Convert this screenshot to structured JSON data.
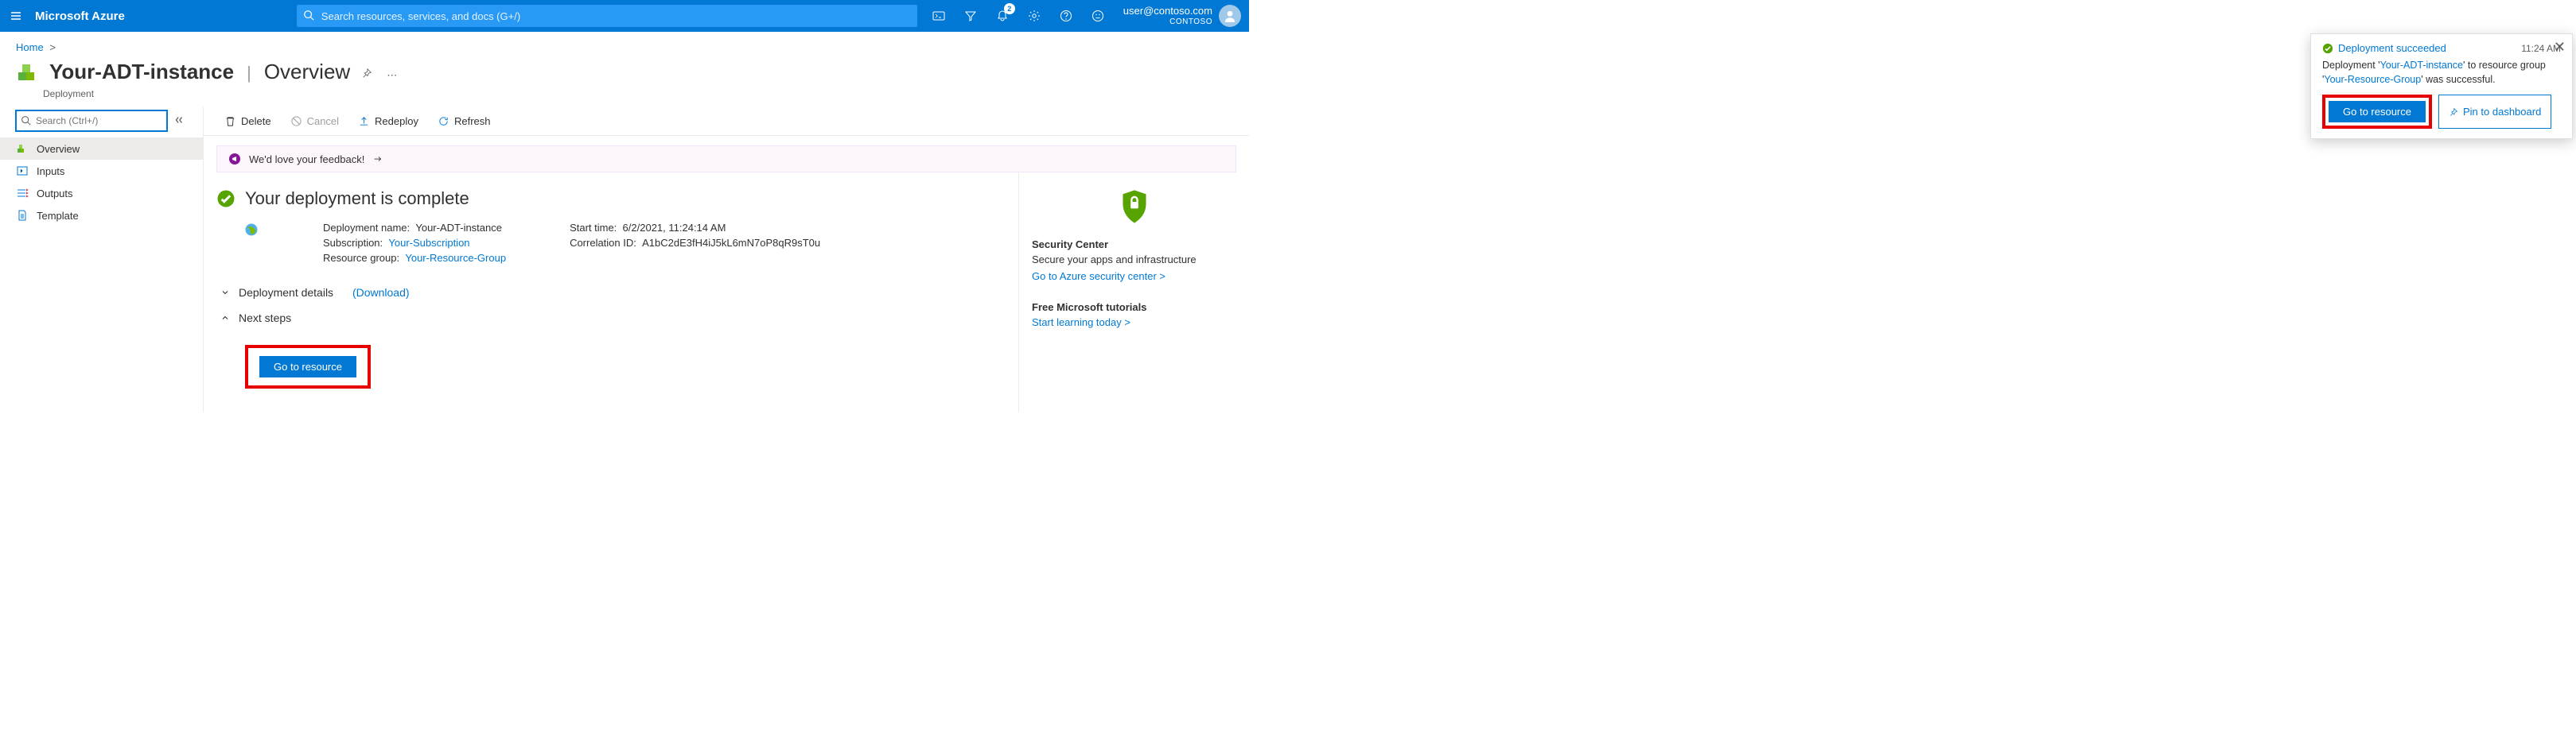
{
  "topbar": {
    "brand": "Microsoft Azure",
    "search_placeholder": "Search resources, services, and docs (G+/)",
    "notification_count": "2",
    "account_email": "user@contoso.com",
    "account_tenant": "CONTOSO"
  },
  "breadcrumb": {
    "home": "Home"
  },
  "blade": {
    "title": "Your-ADT-instance",
    "section": "Overview",
    "subtitle": "Deployment"
  },
  "sidebar": {
    "search_placeholder": "Search (Ctrl+/)",
    "items": [
      {
        "label": "Overview",
        "icon": "overview",
        "active": true
      },
      {
        "label": "Inputs",
        "icon": "inputs"
      },
      {
        "label": "Outputs",
        "icon": "outputs"
      },
      {
        "label": "Template",
        "icon": "template"
      }
    ]
  },
  "commands": {
    "delete": "Delete",
    "cancel": "Cancel",
    "redeploy": "Redeploy",
    "refresh": "Refresh"
  },
  "feedback": {
    "text": "We'd love your feedback!"
  },
  "status": {
    "title": "Your deployment is complete"
  },
  "details": {
    "deployment_name_label": "Deployment name:",
    "deployment_name": "Your-ADT-instance",
    "subscription_label": "Subscription:",
    "subscription": "Your-Subscription",
    "resource_group_label": "Resource group:",
    "resource_group": "Your-Resource-Group",
    "start_time_label": "Start time:",
    "start_time": "6/2/2021, 11:24:14 AM",
    "correlation_id_label": "Correlation ID:",
    "correlation_id": "A1bC2dE3fH4iJ5kL6mN7oP8qR9sT0u"
  },
  "sections": {
    "deployment_details": "Deployment details",
    "download": "(Download)",
    "next_steps": "Next steps",
    "go_to_resource": "Go to resource"
  },
  "right_rail": {
    "security_h": "Security Center",
    "security_p": "Secure your apps and infrastructure",
    "security_link": "Go to Azure security center >",
    "tutorials_h": "Free Microsoft tutorials",
    "tutorials_link": "Start learning today >"
  },
  "toast": {
    "title": "Deployment succeeded",
    "time": "11:24 AM",
    "body_prefix": "Deployment '",
    "body_dep": "Your-ADT-instance",
    "body_mid": "' to resource group '",
    "body_rg": "Your-Resource-Group",
    "body_suffix": "' was successful.",
    "btn_goto": "Go to resource",
    "btn_pin": "Pin to dashboard"
  }
}
